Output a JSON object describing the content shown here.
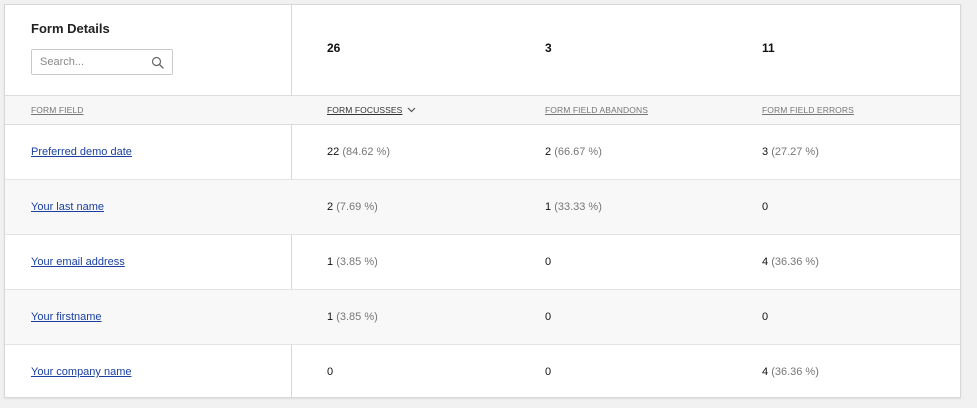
{
  "panel": {
    "title": "Form Details",
    "search": {
      "placeholder": "Search...",
      "value": ""
    }
  },
  "totals": {
    "form_focusses": "26",
    "form_field_abandons": "3",
    "form_field_errors": "11"
  },
  "columns": {
    "form_field": "FORM FIELD",
    "form_focusses": "FORM FOCUSSES",
    "form_field_abandons": "FORM FIELD ABANDONS",
    "form_field_errors": "FORM FIELD ERRORS"
  },
  "sort": {
    "column": "form_focusses",
    "direction": "desc"
  },
  "rows": [
    {
      "field": "Preferred demo date",
      "focusses": {
        "value": "22",
        "pct": "(84.62 %)"
      },
      "abandons": {
        "value": "2",
        "pct": "(66.67 %)"
      },
      "errors": {
        "value": "3",
        "pct": "(27.27 %)"
      }
    },
    {
      "field": "Your last name",
      "focusses": {
        "value": "2",
        "pct": "(7.69 %)"
      },
      "abandons": {
        "value": "1",
        "pct": "(33.33 %)"
      },
      "errors": {
        "value": "0",
        "pct": ""
      }
    },
    {
      "field": "Your email address",
      "focusses": {
        "value": "1",
        "pct": "(3.85 %)"
      },
      "abandons": {
        "value": "0",
        "pct": ""
      },
      "errors": {
        "value": "4",
        "pct": "(36.36 %)"
      }
    },
    {
      "field": "Your firstname",
      "focusses": {
        "value": "1",
        "pct": "(3.85 %)"
      },
      "abandons": {
        "value": "0",
        "pct": ""
      },
      "errors": {
        "value": "0",
        "pct": ""
      }
    },
    {
      "field": "Your company name",
      "focusses": {
        "value": "0",
        "pct": ""
      },
      "abandons": {
        "value": "0",
        "pct": ""
      },
      "errors": {
        "value": "4",
        "pct": "(36.36 %)"
      }
    }
  ],
  "colors": {
    "link": "#1a3fa0",
    "muted": "#777777",
    "border": "#d6d6d6",
    "row_alt": "#f8f8f8"
  }
}
